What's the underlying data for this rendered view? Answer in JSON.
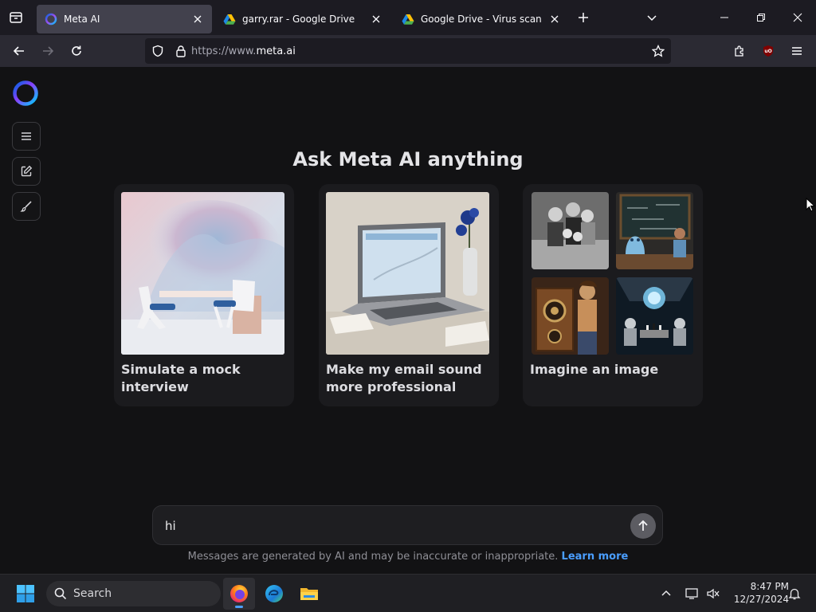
{
  "browser": {
    "tabs": [
      {
        "title": "Meta AI",
        "favicon": "meta-ai-ring-icon",
        "active": true
      },
      {
        "title": "garry.rar - Google Drive",
        "favicon": "google-drive-icon",
        "active": false
      },
      {
        "title": "Google Drive - Virus scan warni",
        "favicon": "google-drive-icon",
        "active": false
      }
    ],
    "url_scheme": "https://www.",
    "url_host": "meta.ai",
    "extension_badge": "uO"
  },
  "page": {
    "headline": "Ask Meta AI anything",
    "cards": [
      {
        "label": "Simulate a mock interview",
        "image": "interview-room-image"
      },
      {
        "label": "Make my email sound more professional",
        "image": "laptop-email-image"
      },
      {
        "label": "Imagine an image",
        "image": "image-collage"
      }
    ],
    "composer": {
      "value": "hi"
    },
    "disclaimer": "Messages are generated by AI and may be inaccurate or inappropriate.",
    "learn_more": "Learn more"
  },
  "taskbar": {
    "search_label": "Search",
    "time": "8:47 PM",
    "date": "12/27/2024"
  },
  "colors": {
    "accent_link": "#4a9eff",
    "page_bg": "#121214",
    "card_bg": "#1b1b1e"
  }
}
